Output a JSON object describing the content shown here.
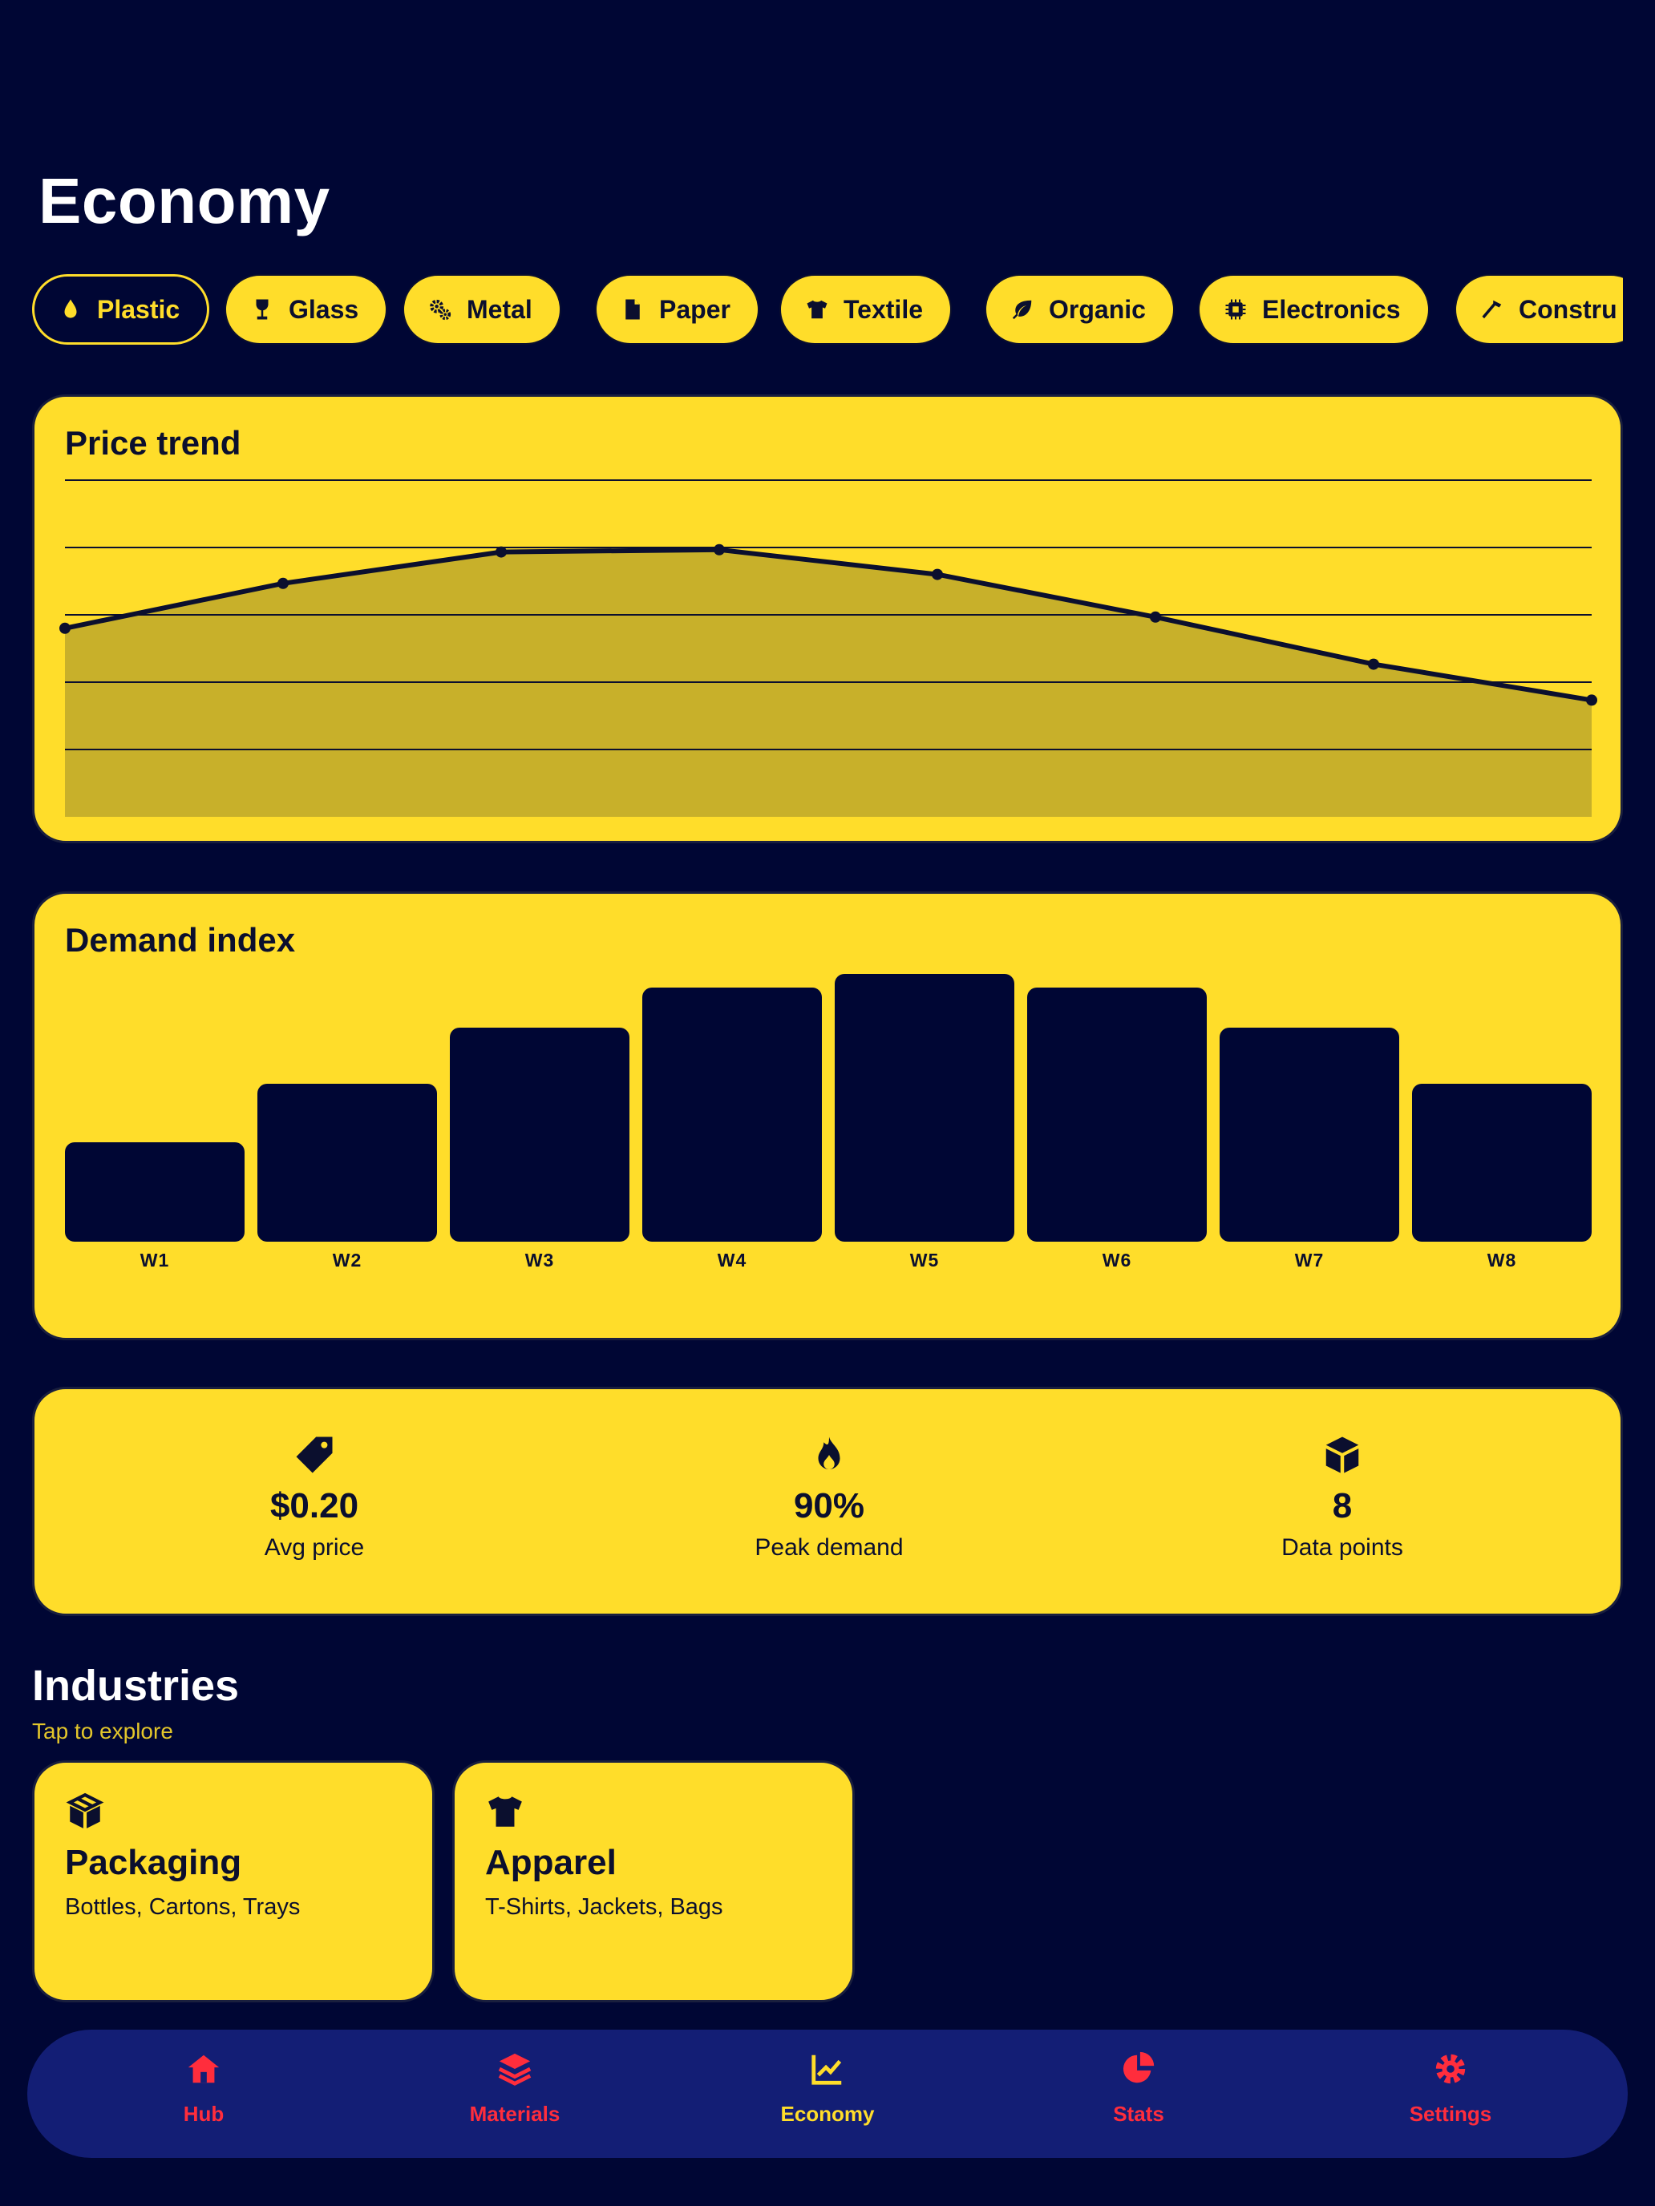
{
  "page": {
    "title": "Economy"
  },
  "materials": [
    {
      "label": "Plastic",
      "icon": "droplet-icon",
      "active": true
    },
    {
      "label": "Glass",
      "icon": "wine-glass-icon",
      "active": false
    },
    {
      "label": "Metal",
      "icon": "gears-icon",
      "active": false
    },
    {
      "label": "Paper",
      "icon": "file-icon",
      "active": false
    },
    {
      "label": "Textile",
      "icon": "shirt-icon",
      "active": false
    },
    {
      "label": "Organic",
      "icon": "leaf-icon",
      "active": false
    },
    {
      "label": "Electronics",
      "icon": "chip-icon",
      "active": false
    },
    {
      "label": "Constru",
      "icon": "hammer-icon",
      "active": false
    }
  ],
  "price_trend": {
    "title": "Price trend"
  },
  "demand": {
    "title": "Demand index"
  },
  "chart_data": [
    {
      "type": "area",
      "title": "Price trend",
      "x": [
        1,
        2,
        3,
        4,
        5,
        6,
        7,
        8
      ],
      "values": [
        0.184,
        0.204,
        0.218,
        0.219,
        0.208,
        0.189,
        0.168,
        0.152
      ],
      "ylim": [
        0.1,
        0.25
      ],
      "grid": true,
      "xlabel": "",
      "ylabel": ""
    },
    {
      "type": "bar",
      "title": "Demand index",
      "categories": [
        "W1",
        "W2",
        "W3",
        "W4",
        "W5",
        "W6",
        "W7",
        "W8"
      ],
      "values": [
        37,
        59,
        80,
        95,
        100,
        95,
        80,
        59
      ],
      "ylim": [
        0,
        100
      ],
      "xlabel": "",
      "ylabel": ""
    }
  ],
  "stats": [
    {
      "icon": "tag-icon",
      "value": "$0.20",
      "label": "Avg price"
    },
    {
      "icon": "fire-icon",
      "value": "90%",
      "label": "Peak demand"
    },
    {
      "icon": "cube-icon",
      "value": "8",
      "label": "Data points"
    }
  ],
  "industries": {
    "title": "Industries",
    "subtitle": "Tap to explore",
    "items": [
      {
        "icon": "box-icon",
        "title": "Packaging",
        "subtitle": "Bottles, Cartons, Trays"
      },
      {
        "icon": "shirt-icon",
        "title": "Apparel",
        "subtitle": "T-Shirts, Jackets, Bags"
      }
    ]
  },
  "nav": [
    {
      "label": "Hub",
      "icon": "house-icon",
      "active": false
    },
    {
      "label": "Materials",
      "icon": "layers-icon",
      "active": false
    },
    {
      "label": "Economy",
      "icon": "chart-line-icon",
      "active": true
    },
    {
      "label": "Stats",
      "icon": "pie-chart-icon",
      "active": false
    },
    {
      "label": "Settings",
      "icon": "gear-icon",
      "active": false
    }
  ],
  "colors": {
    "background": "#000634",
    "accent": "#ffdd2a",
    "nav_bg": "#131e75",
    "nav_inactive": "#ff2d3c",
    "ink": "#0b0f2e"
  }
}
